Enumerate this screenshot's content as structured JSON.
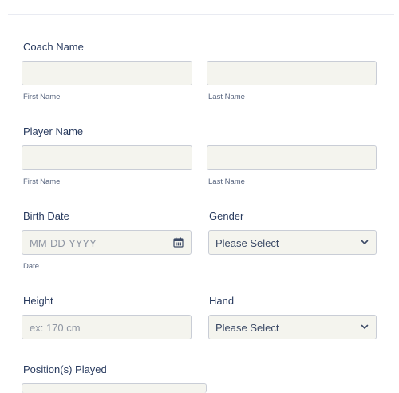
{
  "coach": {
    "label": "Coach Name",
    "first_sublabel": "First Name",
    "last_sublabel": "Last Name"
  },
  "player": {
    "label": "Player Name",
    "first_sublabel": "First Name",
    "last_sublabel": "Last Name"
  },
  "birth_date": {
    "label": "Birth Date",
    "placeholder": "MM-DD-YYYY",
    "sublabel": "Date",
    "icon": "calendar-icon"
  },
  "gender": {
    "label": "Gender",
    "selected": "Please Select",
    "icon": "chevron-down-icon"
  },
  "height": {
    "label": "Height",
    "placeholder": "ex: 170 cm"
  },
  "hand": {
    "label": "Hand",
    "selected": "Please Select",
    "icon": "chevron-down-icon"
  },
  "positions": {
    "label": "Position(s) Played"
  },
  "colors": {
    "field_bg": "#f4f4ee",
    "field_border": "#c9cdd6",
    "label_text": "#283a5e"
  }
}
